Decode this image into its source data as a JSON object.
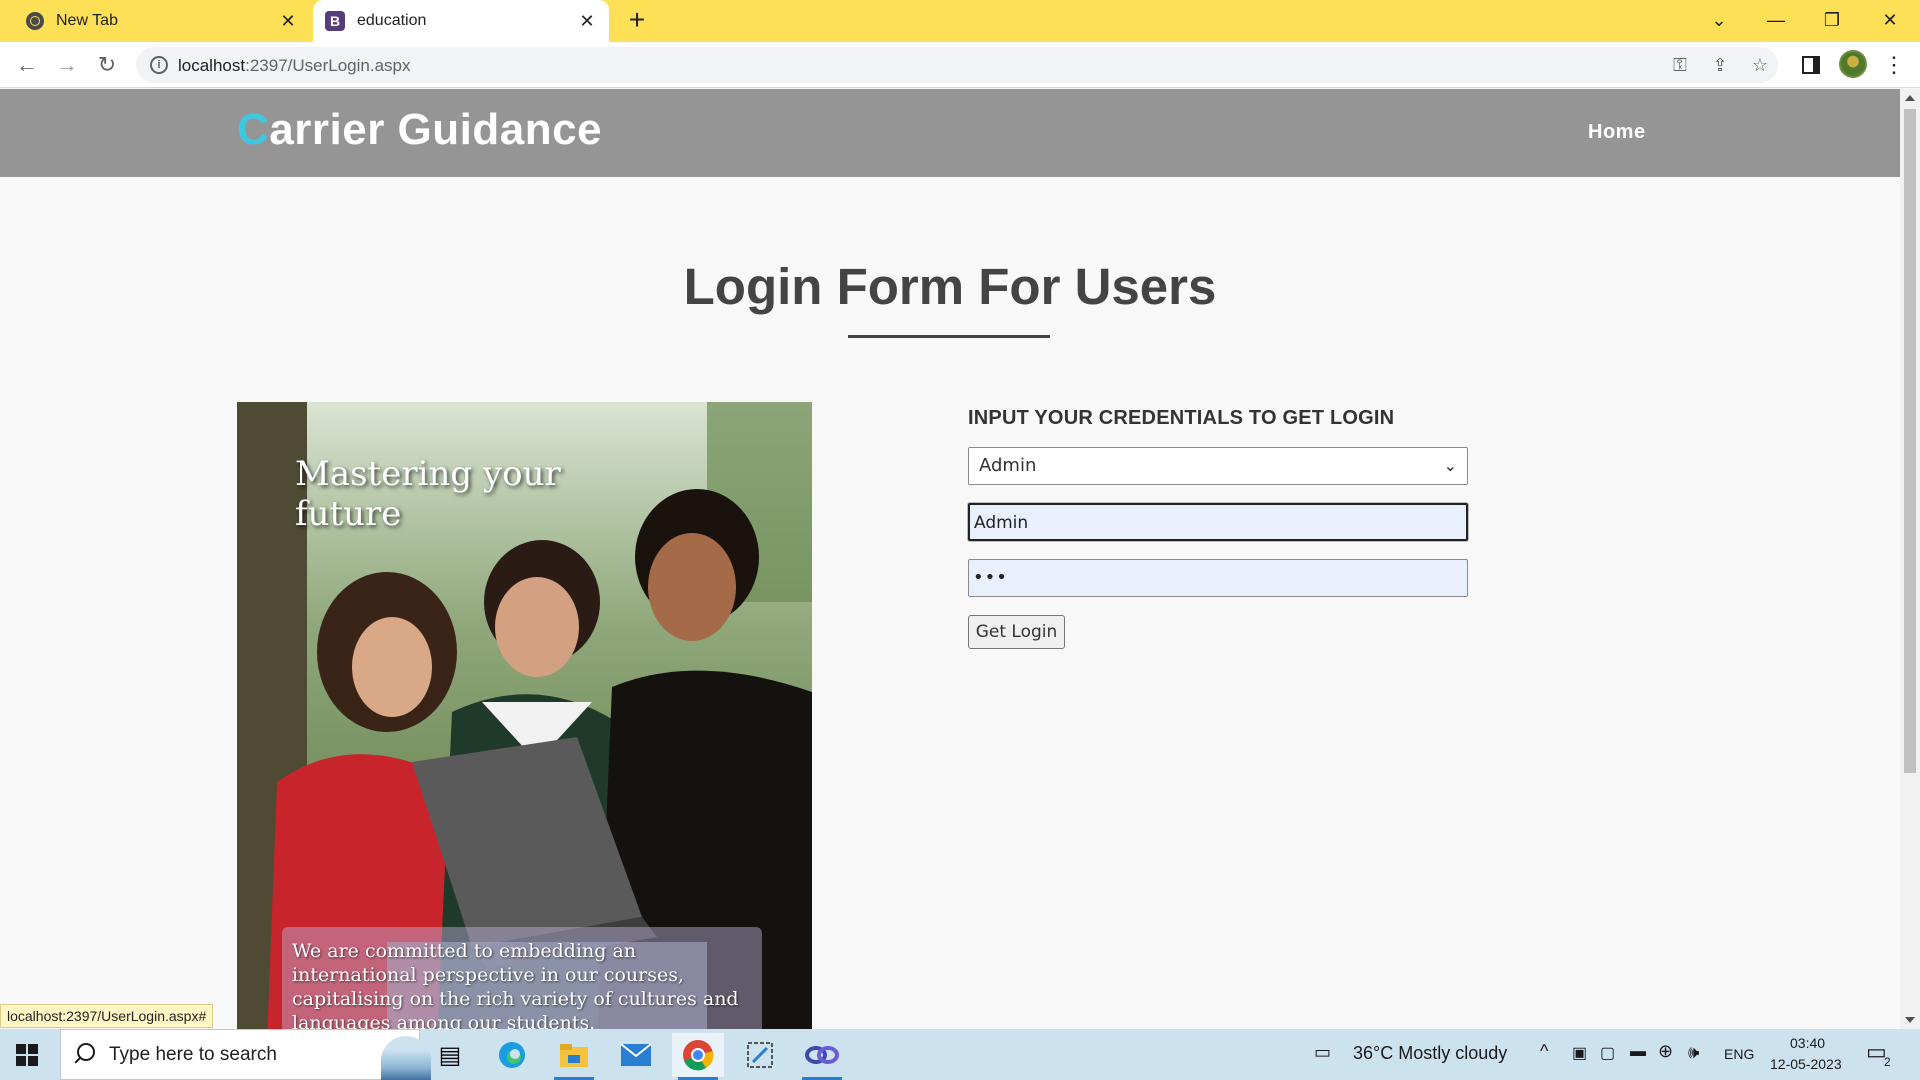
{
  "browser": {
    "tabs": [
      {
        "title": "New Tab",
        "icon": "chrome-icon"
      },
      {
        "title": "education",
        "icon": "bootstrap-icon"
      }
    ],
    "url": {
      "host": "localhost",
      "rest": ":2397/UserLogin.aspx"
    },
    "status_url": "localhost:2397/UserLogin.aspx#",
    "theme_color": "#fde056"
  },
  "site": {
    "brand_first": "C",
    "brand_rest": "arrier Guidance",
    "nav_home": "Home",
    "nav_color": "#959595",
    "brand_accent": "#3ec8e0"
  },
  "page": {
    "title": "Login Form For Users",
    "hero": {
      "headline": "Mastering your future",
      "caption": "We are committed to embedding an international perspective in our courses, capitalising on the rich variety of cultures and languages among our students."
    },
    "form": {
      "heading": "INPUT YOUR CREDENTIALS TO GET LOGIN",
      "role_selected": "Admin",
      "username_value": "Admin",
      "password_mask": "•••",
      "submit_label": "Get Login"
    }
  },
  "taskbar": {
    "search_placeholder": "Type here to search",
    "weather": "36°C  Mostly cloudy",
    "language": "ENG",
    "time": "03:40",
    "date": "12-05-2023",
    "notifications": "2"
  }
}
